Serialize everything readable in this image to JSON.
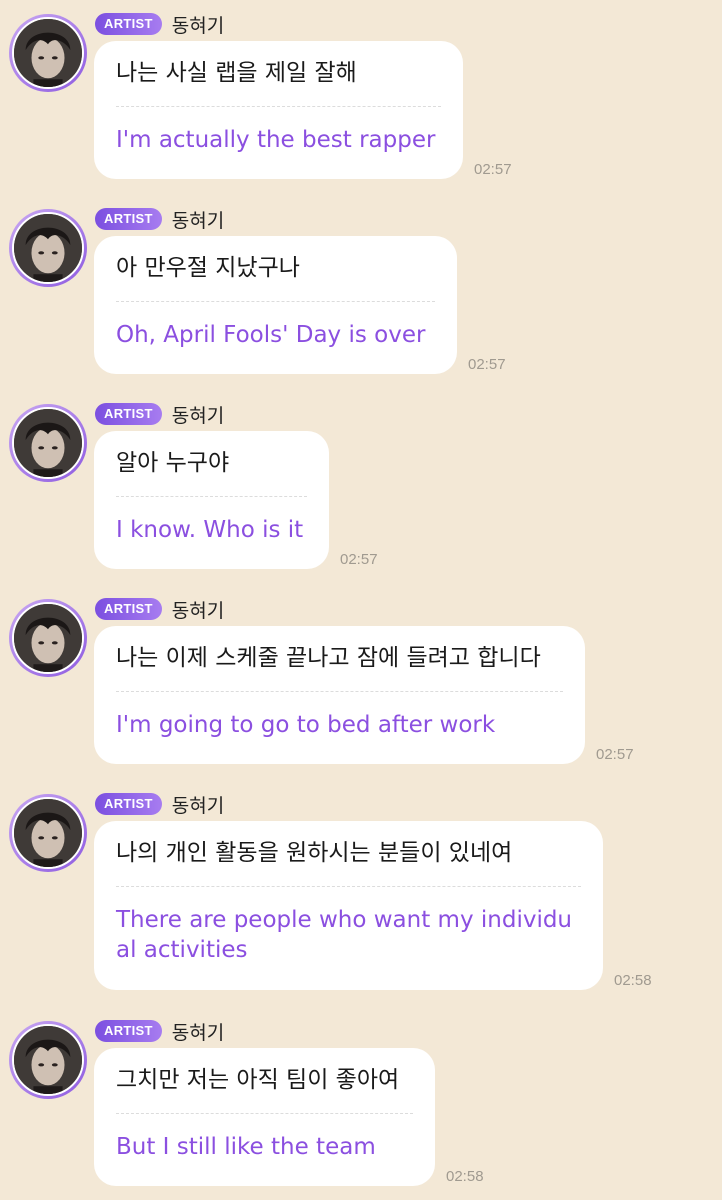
{
  "messages": [
    {
      "badge": "ARTIST",
      "name": "동혀기",
      "korean": "나는 사실 랩을 제일 잘해",
      "english": "I'm actually the best rapper",
      "time": "02:57"
    },
    {
      "badge": "ARTIST",
      "name": "동혀기",
      "korean": "아 만우절 지났구나",
      "english": "Oh, April Fools' Day is over",
      "time": "02:57"
    },
    {
      "badge": "ARTIST",
      "name": "동혀기",
      "korean": "알아 누구야",
      "english": "I know. Who is it",
      "time": "02:57"
    },
    {
      "badge": "ARTIST",
      "name": "동혀기",
      "korean": "나는 이제 스케줄 끝나고 잠에 들려고 합니다",
      "english": "I'm going to go to bed after work",
      "time": "02:57"
    },
    {
      "badge": "ARTIST",
      "name": "동혀기",
      "korean": "나의 개인 활동을 원하시는 분들이 있네여",
      "english_lines": [
        "There are people who want my individu",
        "al activities"
      ],
      "time": "02:58"
    },
    {
      "badge": "ARTIST",
      "name": "동혀기",
      "korean": "그치만 저는 아직 팀이 좋아여",
      "english": "But I still like the team",
      "time": "02:58"
    }
  ],
  "colors": {
    "background": "#f3e8d6",
    "bubble": "#ffffff",
    "translation": "#8b4fe0",
    "badge_start": "#7b4fe0",
    "badge_end": "#a77cf0",
    "timestamp": "#a09a90"
  },
  "icons": {
    "avatar": "artist-avatar-photo"
  }
}
